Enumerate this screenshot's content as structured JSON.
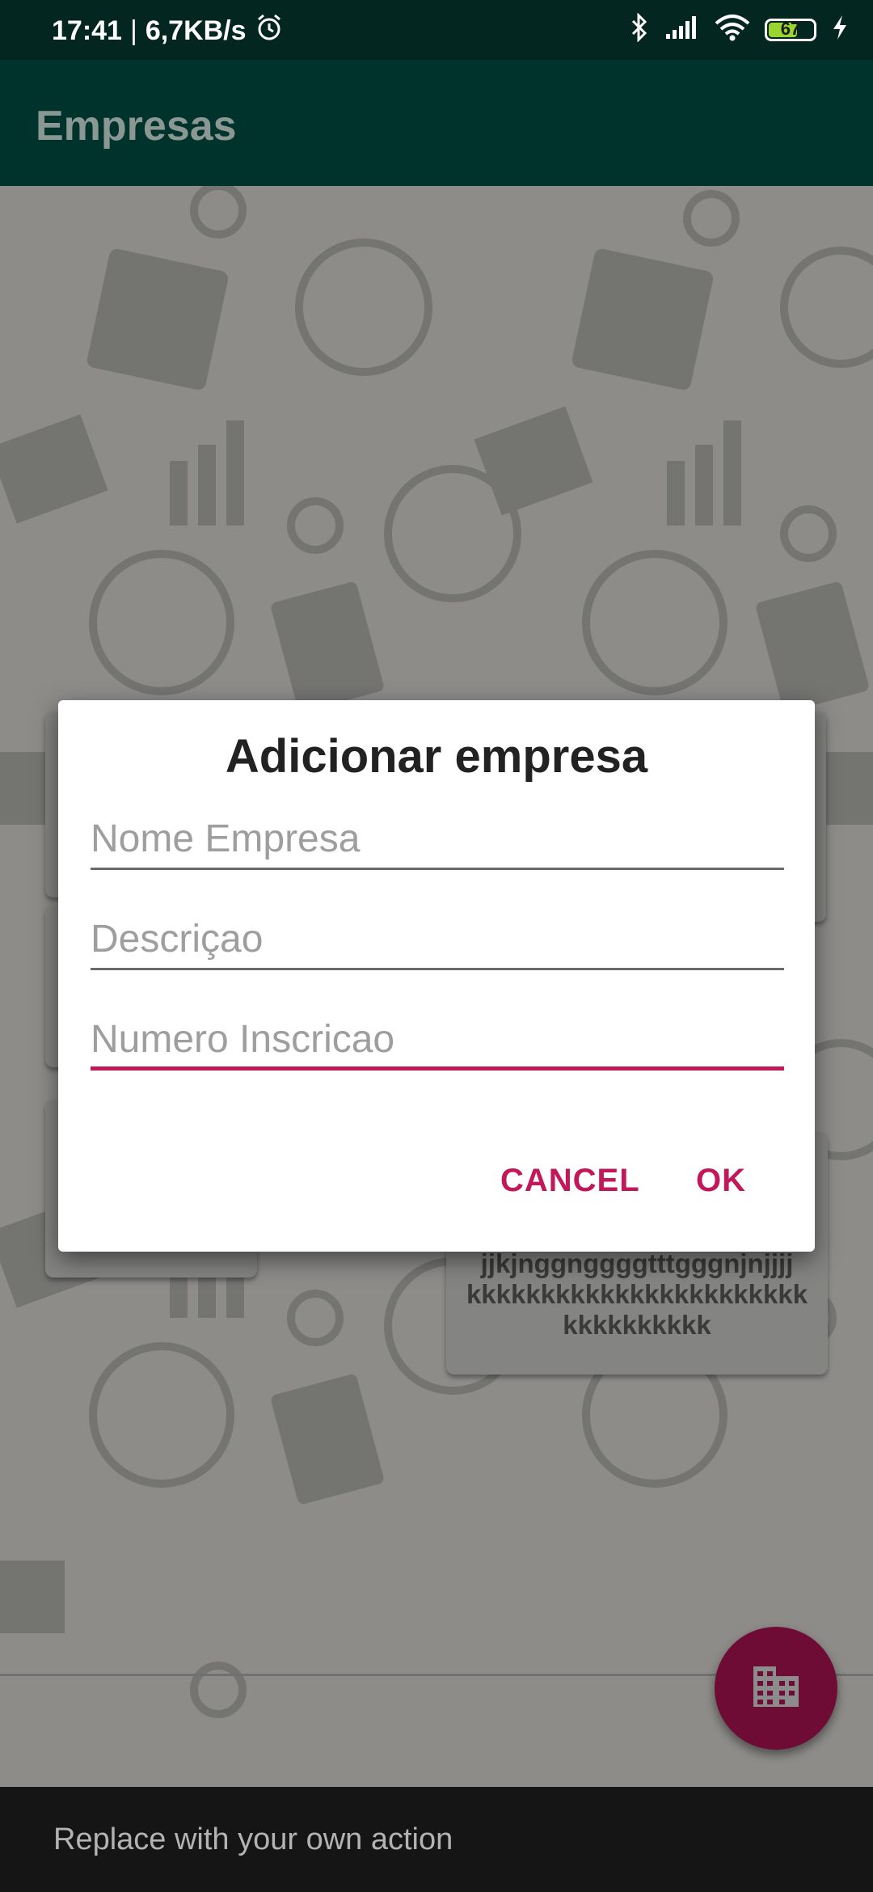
{
  "status_bar": {
    "time": "17:41",
    "separator": "|",
    "network_speed": "6,7KB/s",
    "battery_level": "67",
    "icons": [
      "alarm-icon",
      "bluetooth-icon",
      "signal-icon",
      "wifi-icon",
      "battery-icon",
      "charging-icon"
    ]
  },
  "app_bar": {
    "title": "Empresas"
  },
  "background_card": {
    "text_line1": "jjkjnggnggggtttgggnjnjjjj",
    "text_line2": "kkkkkkkkkkkkkkkkkkkkkkk",
    "text_line3": "kkkkkkkkkk"
  },
  "dialog": {
    "title": "Adicionar empresa",
    "fields": [
      {
        "placeholder": "Nome Empresa",
        "value": ""
      },
      {
        "placeholder": "Descriçao",
        "value": ""
      },
      {
        "placeholder": "Numero Inscricao",
        "value": ""
      }
    ],
    "cancel_label": "CANCEL",
    "ok_label": "OK"
  },
  "fab": {
    "icon": "business-icon"
  },
  "snackbar": {
    "text": "Replace with your own action"
  },
  "colors": {
    "status_bar": "#042621",
    "app_bar": "#01332d",
    "accent": "#c2185b",
    "fab": "#6e0c35",
    "snackbar": "#151515"
  }
}
